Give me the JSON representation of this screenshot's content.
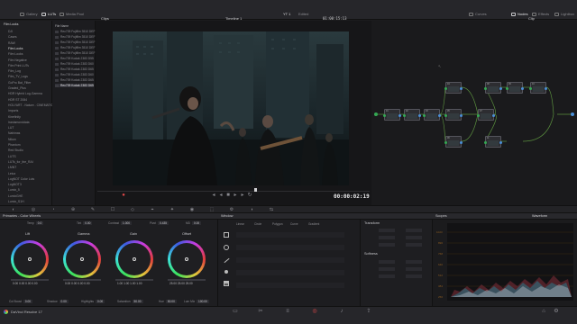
{
  "topbar": {
    "gallery": "Gallery",
    "luts": "LUTs",
    "media_pool": "Media Pool",
    "clips": "Clips",
    "timeline": "Timeline 1",
    "project": "YT 1",
    "edited": "Edited",
    "timecode_top": "01:00:15:13",
    "curves": "Curves",
    "color_warper": "Color Warper",
    "qualifier": "Qualifier",
    "nodes": "Nodes",
    "effects": "Effects",
    "lightbox": "Lightbox",
    "clip_label": "Clip"
  },
  "luts_tree": {
    "header": "Film Looks",
    "items": [
      "DJI",
      "Cases",
      "RAW",
      "Film Looks",
      "Film Looks",
      "Film Negative",
      "Film Print LUTs",
      "Film_Log",
      "Film_TV_Logs",
      "GoPro Bat_Filter",
      "Graded_Plus",
      "HDR Hybrid Log-Gamma",
      "HDR ST 2084",
      "HOLYART - Nature - CINEMATIC",
      "Imports",
      "Kinefinity",
      "Iraniamonddata",
      "LUT",
      "Nahimas",
      "Nikon",
      "Phantom",
      "Red Studio",
      "LUTS",
      "LUTs_for_the_RAI",
      "LMNT",
      "Leica",
      "LogNOT Color Luts",
      "LogNOT3",
      "Lumix_5",
      "LumixGHE",
      "Lumix_S1H"
    ],
    "selected_index": 3
  },
  "lut_list": {
    "header": "File Name",
    "items": [
      "Rec709 Fujifilm 3510 DEF",
      "Rec709 Fujifilm 3510 DEF",
      "Rec709 Fujifilm 3510 DEF",
      "Rec709 Fujifilm 3510 DEF",
      "Rec709 Fujifilm 3510 DEF",
      "Rec709 Kodak 2383 D55",
      "Rec709 Kodak 2383 D60",
      "Rec709 Kodak 2383 D65",
      "Rec709 Kodak 2383 D60",
      "Rec709 Kodak 2383 D65",
      "Rec709 Kodak 2383 D65"
    ],
    "selected_index": 10
  },
  "viewer": {
    "timecode": "00:00:02:19"
  },
  "nodes": [
    "01",
    "02",
    "03",
    "04",
    "05",
    "06",
    "07",
    "08",
    "09",
    "10",
    "11"
  ],
  "panels": {
    "color_wheels": "Primaries - Color Wheels",
    "window": "Window",
    "transform": "Transform",
    "softness": "Softness",
    "scopes": "Scopes",
    "waveform": "Waveform"
  },
  "wheel_params": {
    "temp": "0.0",
    "tint": "0.00",
    "contrast": "1.000",
    "pivot": "0.435",
    "md": "0.00",
    "col_boost": "0.00",
    "shadow": "0.00",
    "highlights": "0.00",
    "saturation": "50.00",
    "hue": "50.00",
    "lum_mix": "100.00"
  },
  "wheels": [
    {
      "name": "Lift",
      "values": "0.00   0.00   0.00   0.00"
    },
    {
      "name": "Gamma",
      "values": "0.00   0.00   0.00   0.00"
    },
    {
      "name": "Gain",
      "values": "1.00   1.00   1.00   1.00"
    },
    {
      "name": "Offset",
      "values": "25.00   25.00   25.00"
    }
  ],
  "window_tools": [
    "Linear",
    "Circle",
    "Polygon",
    "Curve",
    "Gradient"
  ],
  "bottombar": {
    "app": "DaVinci Resolve 17"
  }
}
